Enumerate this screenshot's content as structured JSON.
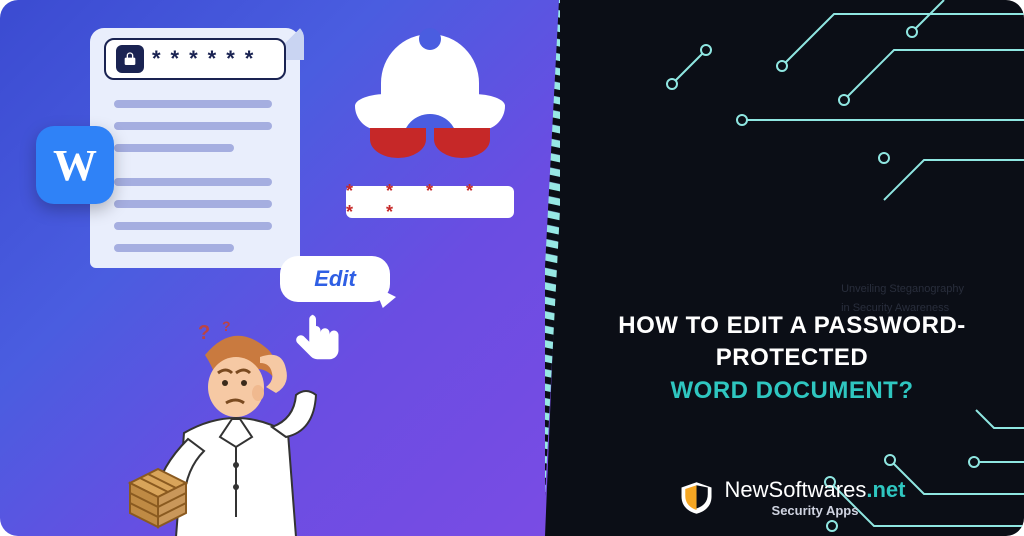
{
  "left": {
    "word_icon_letter": "W",
    "password_mask": "******",
    "hacker_password_mask": "* * * * * *",
    "edit_label": "Edit"
  },
  "right": {
    "ghost_line1": "Unveiling Steganography",
    "ghost_line2": "in Security Awareness",
    "title_line1": "HOW TO EDIT A PASSWORD-PROTECTED",
    "title_line2": "WORD DOCUMENT?",
    "brand_name": "NewSoftwares",
    "brand_suffix": ".net",
    "brand_tagline": "Security Apps"
  },
  "colors": {
    "accent": "#2fc6c0",
    "left_gradient_start": "#3b4bd1",
    "left_gradient_end": "#7a4ce4",
    "right_bg": "#0b0e16"
  }
}
